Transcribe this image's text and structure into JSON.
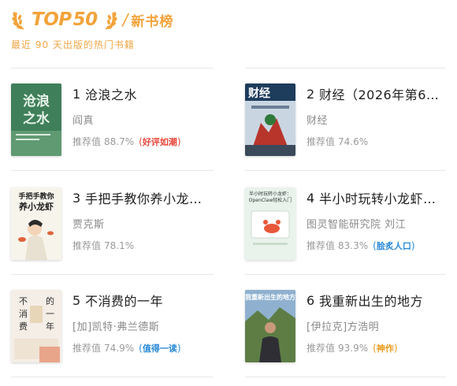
{
  "header": {
    "brand_top": "TOP",
    "brand_50": "50",
    "slash": "/",
    "title": "新书榜",
    "subtitle": "最近 90 天出版的热门书籍"
  },
  "books": [
    {
      "rank": "1",
      "title": "沧浪之水",
      "author": "阎真",
      "score_label": "推荐值",
      "score": "88.7%",
      "badge": "好评如潮",
      "badge_color": "#e8463a",
      "cover": {
        "bg": "#3f7f5a",
        "text": "沧浪之水",
        "text_color": "#e8f3ea",
        "sub": "阎真",
        "style": "green"
      }
    },
    {
      "rank": "2",
      "title": "财经（2026年第6…",
      "author": "财经",
      "score_label": "推荐值",
      "score": "74.6%",
      "badge": "",
      "badge_color": "",
      "cover": {
        "bg": "#2a4a6e",
        "text": "财经",
        "text_color": "#ffffff",
        "sub": "",
        "style": "magazine"
      }
    },
    {
      "rank": "3",
      "title": "手把手教你养小龙…",
      "author": "贾克斯",
      "score_label": "推荐值",
      "score": "78.1%",
      "badge": "",
      "badge_color": "",
      "cover": {
        "bg": "#f7f4ec",
        "text": "手把手教你养小龙虾",
        "text_color": "#1a1a1a",
        "sub": "贾克斯",
        "style": "cartoon"
      }
    },
    {
      "rank": "4",
      "title": "半小时玩转小龙虾…",
      "author": "图灵智能研究院 刘江",
      "score_label": "推荐值",
      "score": "83.3%",
      "badge": "脍炙人口",
      "badge_color": "#2a8ad8",
      "cover": {
        "bg": "#e9f3ec",
        "text": "半小时玩转小龙虾：OpenClaw轻松入门",
        "text_color": "#333333",
        "sub": "",
        "style": "lobster"
      }
    },
    {
      "rank": "5",
      "title": "不消费的一年",
      "author": "[加]凯特·弗兰德斯",
      "score_label": "推荐值",
      "score": "74.9%",
      "badge": "值得一读",
      "badge_color": "#2a8ad8",
      "cover": {
        "bg": "#f4eee7",
        "text": "不消费的一年",
        "text_color": "#2c2c2c",
        "sub": "",
        "style": "plain"
      }
    },
    {
      "rank": "6",
      "title": "我重新出生的地方",
      "author": "[伊拉克]方浩明",
      "score_label": "推荐值",
      "score": "93.9%",
      "badge": "神作",
      "badge_color": "#e89a1c",
      "cover": {
        "bg": "#6b8a4e",
        "text": "我重新出生的地方",
        "text_color": "#ffffff",
        "sub": "",
        "style": "photo"
      }
    }
  ],
  "colors": {
    "accent": "#f2a33a",
    "divider": "#e8e8e8"
  },
  "icons": {
    "laurel_left": "laurel-left-icon",
    "laurel_right": "laurel-right-icon"
  }
}
